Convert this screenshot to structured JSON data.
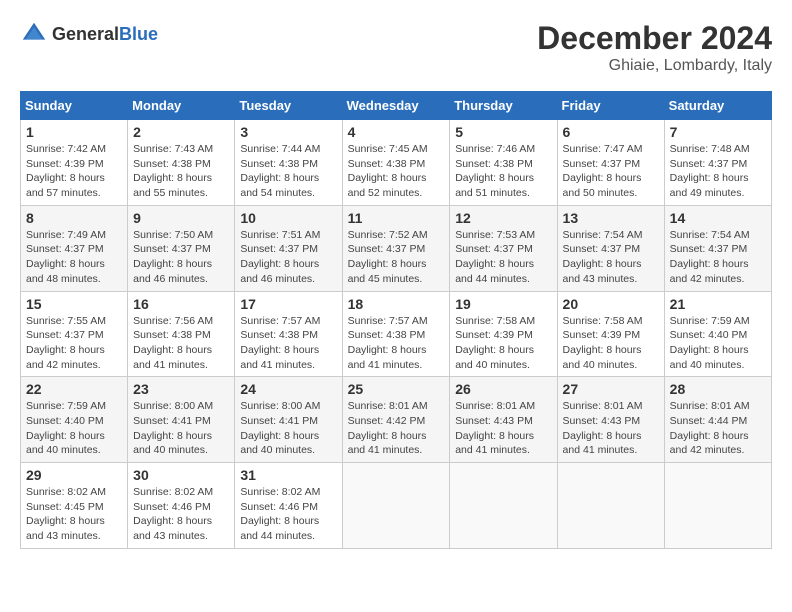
{
  "header": {
    "logo_general": "General",
    "logo_blue": "Blue",
    "month_title": "December 2024",
    "location": "Ghiaie, Lombardy, Italy"
  },
  "columns": [
    "Sunday",
    "Monday",
    "Tuesday",
    "Wednesday",
    "Thursday",
    "Friday",
    "Saturday"
  ],
  "weeks": [
    [
      {
        "day": "1",
        "sunrise": "Sunrise: 7:42 AM",
        "sunset": "Sunset: 4:39 PM",
        "daylight": "Daylight: 8 hours and 57 minutes."
      },
      {
        "day": "2",
        "sunrise": "Sunrise: 7:43 AM",
        "sunset": "Sunset: 4:38 PM",
        "daylight": "Daylight: 8 hours and 55 minutes."
      },
      {
        "day": "3",
        "sunrise": "Sunrise: 7:44 AM",
        "sunset": "Sunset: 4:38 PM",
        "daylight": "Daylight: 8 hours and 54 minutes."
      },
      {
        "day": "4",
        "sunrise": "Sunrise: 7:45 AM",
        "sunset": "Sunset: 4:38 PM",
        "daylight": "Daylight: 8 hours and 52 minutes."
      },
      {
        "day": "5",
        "sunrise": "Sunrise: 7:46 AM",
        "sunset": "Sunset: 4:38 PM",
        "daylight": "Daylight: 8 hours and 51 minutes."
      },
      {
        "day": "6",
        "sunrise": "Sunrise: 7:47 AM",
        "sunset": "Sunset: 4:37 PM",
        "daylight": "Daylight: 8 hours and 50 minutes."
      },
      {
        "day": "7",
        "sunrise": "Sunrise: 7:48 AM",
        "sunset": "Sunset: 4:37 PM",
        "daylight": "Daylight: 8 hours and 49 minutes."
      }
    ],
    [
      {
        "day": "8",
        "sunrise": "Sunrise: 7:49 AM",
        "sunset": "Sunset: 4:37 PM",
        "daylight": "Daylight: 8 hours and 48 minutes."
      },
      {
        "day": "9",
        "sunrise": "Sunrise: 7:50 AM",
        "sunset": "Sunset: 4:37 PM",
        "daylight": "Daylight: 8 hours and 46 minutes."
      },
      {
        "day": "10",
        "sunrise": "Sunrise: 7:51 AM",
        "sunset": "Sunset: 4:37 PM",
        "daylight": "Daylight: 8 hours and 46 minutes."
      },
      {
        "day": "11",
        "sunrise": "Sunrise: 7:52 AM",
        "sunset": "Sunset: 4:37 PM",
        "daylight": "Daylight: 8 hours and 45 minutes."
      },
      {
        "day": "12",
        "sunrise": "Sunrise: 7:53 AM",
        "sunset": "Sunset: 4:37 PM",
        "daylight": "Daylight: 8 hours and 44 minutes."
      },
      {
        "day": "13",
        "sunrise": "Sunrise: 7:54 AM",
        "sunset": "Sunset: 4:37 PM",
        "daylight": "Daylight: 8 hours and 43 minutes."
      },
      {
        "day": "14",
        "sunrise": "Sunrise: 7:54 AM",
        "sunset": "Sunset: 4:37 PM",
        "daylight": "Daylight: 8 hours and 42 minutes."
      }
    ],
    [
      {
        "day": "15",
        "sunrise": "Sunrise: 7:55 AM",
        "sunset": "Sunset: 4:37 PM",
        "daylight": "Daylight: 8 hours and 42 minutes."
      },
      {
        "day": "16",
        "sunrise": "Sunrise: 7:56 AM",
        "sunset": "Sunset: 4:38 PM",
        "daylight": "Daylight: 8 hours and 41 minutes."
      },
      {
        "day": "17",
        "sunrise": "Sunrise: 7:57 AM",
        "sunset": "Sunset: 4:38 PM",
        "daylight": "Daylight: 8 hours and 41 minutes."
      },
      {
        "day": "18",
        "sunrise": "Sunrise: 7:57 AM",
        "sunset": "Sunset: 4:38 PM",
        "daylight": "Daylight: 8 hours and 41 minutes."
      },
      {
        "day": "19",
        "sunrise": "Sunrise: 7:58 AM",
        "sunset": "Sunset: 4:39 PM",
        "daylight": "Daylight: 8 hours and 40 minutes."
      },
      {
        "day": "20",
        "sunrise": "Sunrise: 7:58 AM",
        "sunset": "Sunset: 4:39 PM",
        "daylight": "Daylight: 8 hours and 40 minutes."
      },
      {
        "day": "21",
        "sunrise": "Sunrise: 7:59 AM",
        "sunset": "Sunset: 4:40 PM",
        "daylight": "Daylight: 8 hours and 40 minutes."
      }
    ],
    [
      {
        "day": "22",
        "sunrise": "Sunrise: 7:59 AM",
        "sunset": "Sunset: 4:40 PM",
        "daylight": "Daylight: 8 hours and 40 minutes."
      },
      {
        "day": "23",
        "sunrise": "Sunrise: 8:00 AM",
        "sunset": "Sunset: 4:41 PM",
        "daylight": "Daylight: 8 hours and 40 minutes."
      },
      {
        "day": "24",
        "sunrise": "Sunrise: 8:00 AM",
        "sunset": "Sunset: 4:41 PM",
        "daylight": "Daylight: 8 hours and 40 minutes."
      },
      {
        "day": "25",
        "sunrise": "Sunrise: 8:01 AM",
        "sunset": "Sunset: 4:42 PM",
        "daylight": "Daylight: 8 hours and 41 minutes."
      },
      {
        "day": "26",
        "sunrise": "Sunrise: 8:01 AM",
        "sunset": "Sunset: 4:43 PM",
        "daylight": "Daylight: 8 hours and 41 minutes."
      },
      {
        "day": "27",
        "sunrise": "Sunrise: 8:01 AM",
        "sunset": "Sunset: 4:43 PM",
        "daylight": "Daylight: 8 hours and 41 minutes."
      },
      {
        "day": "28",
        "sunrise": "Sunrise: 8:01 AM",
        "sunset": "Sunset: 4:44 PM",
        "daylight": "Daylight: 8 hours and 42 minutes."
      }
    ],
    [
      {
        "day": "29",
        "sunrise": "Sunrise: 8:02 AM",
        "sunset": "Sunset: 4:45 PM",
        "daylight": "Daylight: 8 hours and 43 minutes."
      },
      {
        "day": "30",
        "sunrise": "Sunrise: 8:02 AM",
        "sunset": "Sunset: 4:46 PM",
        "daylight": "Daylight: 8 hours and 43 minutes."
      },
      {
        "day": "31",
        "sunrise": "Sunrise: 8:02 AM",
        "sunset": "Sunset: 4:46 PM",
        "daylight": "Daylight: 8 hours and 44 minutes."
      },
      {
        "day": "",
        "sunrise": "",
        "sunset": "",
        "daylight": ""
      },
      {
        "day": "",
        "sunrise": "",
        "sunset": "",
        "daylight": ""
      },
      {
        "day": "",
        "sunrise": "",
        "sunset": "",
        "daylight": ""
      },
      {
        "day": "",
        "sunrise": "",
        "sunset": "",
        "daylight": ""
      }
    ]
  ]
}
